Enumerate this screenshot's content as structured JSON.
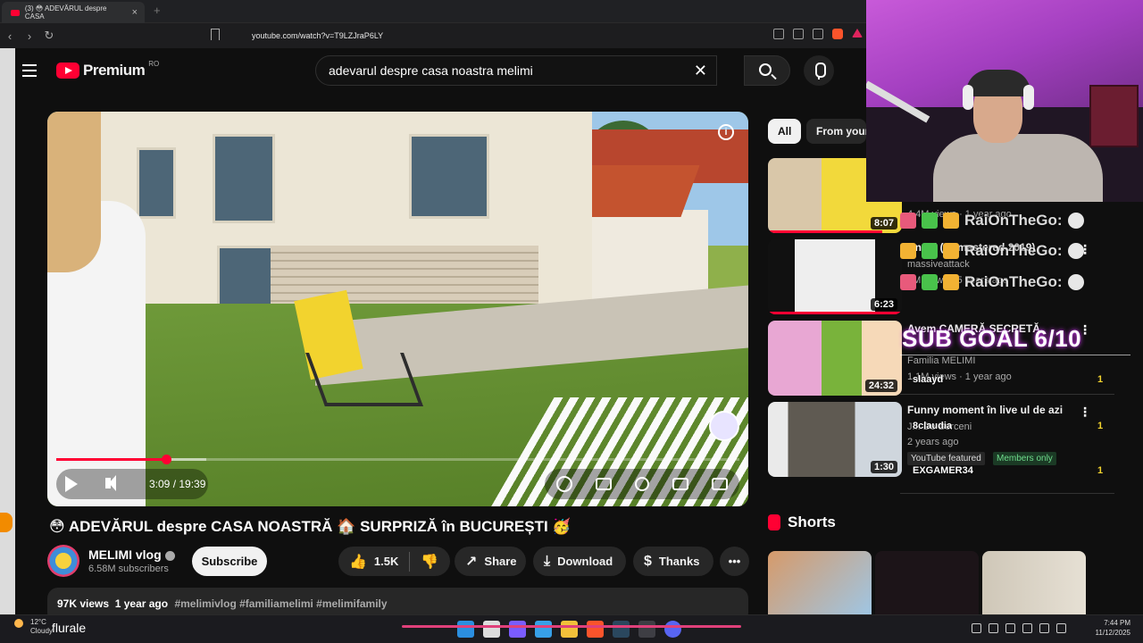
{
  "browser": {
    "tab_title": "(3) 😳 ADEVĂRUL despre CASA",
    "url": "youtube.com/watch?v=T9LZJraP6LY"
  },
  "youtube": {
    "logo_text": "Premium",
    "region": "RO",
    "search_query": "adevarul despre casa noastra melimi"
  },
  "player": {
    "current_time": "3:09",
    "duration": "19:39",
    "time_display": "3:09 / 19:39",
    "progress_fraction": 0.161,
    "buffered_fraction": 0.22
  },
  "video": {
    "title": "😳 ADEVĂRUL despre CASA NOASTRĂ 🏠 SURPRIZĂ în BUCUREȘTI 🥳",
    "channel": "MELIMI vlog",
    "subscribers": "6.58M subscribers",
    "subscribe_label": "Subscribe",
    "likes": "1.5K",
    "share_label": "Share",
    "download_label": "Download",
    "thanks_label": "Thanks",
    "views": "97K views",
    "age": "1 year ago",
    "hashtags": "#melimivlog #familiamelimi #melimifamily"
  },
  "filters": [
    "All",
    "From your"
  ],
  "recommended": [
    {
      "duration": "8:07",
      "title": "",
      "meta1": "4.4M views · 1 year ago",
      "meta2": ""
    },
    {
      "duration": "6:23",
      "title": "Angel (Remastered 2019)",
      "meta1": "massiveattack",
      "meta2": "1M views · 5 years ago"
    },
    {
      "duration": "24:32",
      "title": "Avem CAMERĂ SECRETĂ",
      "meta1": "Familia MELIMI",
      "meta2": "1.1M views · 1 year ago"
    },
    {
      "duration": "1:30",
      "title": "Funny moment în live ul de azi",
      "meta1": "J... De Berceni",
      "meta2": "2 years ago"
    }
  ],
  "badges": {
    "featured": "YouTube featured",
    "members": "Members only"
  },
  "shorts_label": "Shorts",
  "stream_overlay": {
    "chat_user": "RaiOnTheGo:",
    "sub_goal": "SUB GOAL 6/10",
    "leaderboard": [
      {
        "name": "slaayd",
        "value": "1"
      },
      {
        "name": "8claudia",
        "value": "1"
      },
      {
        "name": "EXGAMER34",
        "value": "1"
      }
    ]
  },
  "taskbar": {
    "temperature": "12°C",
    "condition": "Cloudy",
    "search_text": "flurale",
    "time": "7:44 PM",
    "date": "11/12/2025"
  },
  "colors": {
    "accent": "#ff0033",
    "overlay": "#c85ad9",
    "members": "#6fdc8c"
  }
}
